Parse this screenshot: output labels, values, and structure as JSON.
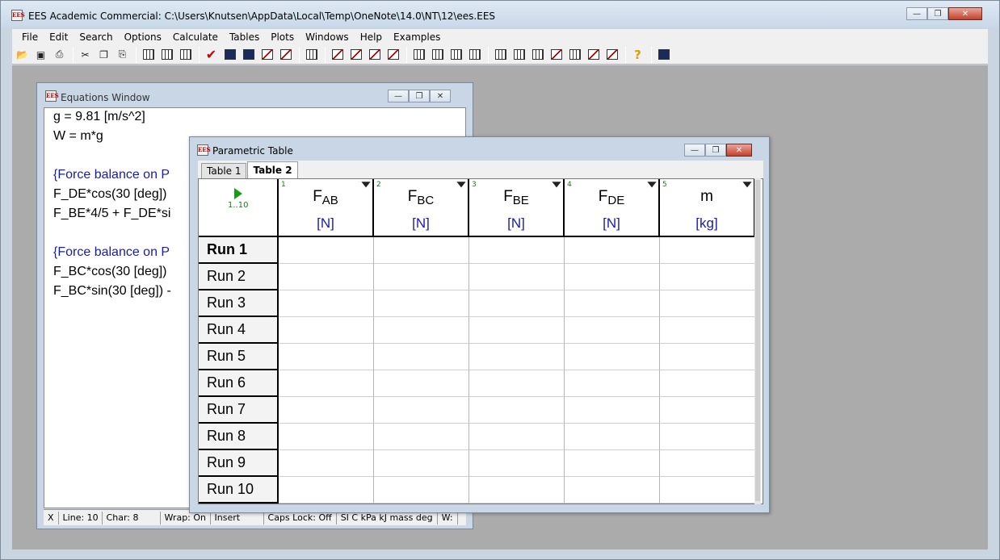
{
  "app": {
    "title": "EES Academic Commercial:  C:\\Users\\Knutsen\\AppData\\Local\\Temp\\OneNote\\14.0\\NT\\12\\ees.EES",
    "icon_text": "EES"
  },
  "menu": [
    "File",
    "Edit",
    "Search",
    "Options",
    "Calculate",
    "Tables",
    "Plots",
    "Windows",
    "Help",
    "Examples"
  ],
  "equations_window": {
    "title": "Equations Window",
    "lines": [
      "g = 9.81 [m/s^2]",
      "W = m*g",
      "",
      "{Force balance on P",
      "F_DE*cos(30 [deg])",
      "F_BE*4/5 + F_DE*si",
      "",
      "{Force balance on P",
      "F_BC*cos(30 [deg])",
      "F_BC*sin(30 [deg]) -"
    ],
    "status": {
      "mode": "X",
      "line": "Line: 10",
      "char": "Char: 8",
      "wrap": "Wrap: On",
      "insert": "Insert",
      "caps": "Caps Lock: Off",
      "units": "SI C kPa kJ mass deg",
      "extra": "W:"
    }
  },
  "parametric_window": {
    "title": "Parametric Table",
    "tabs": [
      "Table 1",
      "Table 2"
    ],
    "active_tab": "Table 2",
    "run_range": "1..10",
    "columns": [
      {
        "num": "1",
        "base": "F",
        "sub": "AB",
        "unit": "[N]"
      },
      {
        "num": "2",
        "base": "F",
        "sub": "BC",
        "unit": "[N]"
      },
      {
        "num": "3",
        "base": "F",
        "sub": "BE",
        "unit": "[N]"
      },
      {
        "num": "4",
        "base": "F",
        "sub": "DE",
        "unit": "[N]"
      },
      {
        "num": "5",
        "base": "m",
        "sub": "",
        "unit": "[kg]"
      }
    ],
    "rows": [
      "Run 1",
      "Run 2",
      "Run 3",
      "Run 4",
      "Run 5",
      "Run 6",
      "Run 7",
      "Run 8",
      "Run 9",
      "Run 10"
    ]
  },
  "toolbar": {
    "icons": [
      "open-icon",
      "save-icon",
      "print-icon",
      "sep",
      "cut-icon",
      "copy-icon",
      "paste-icon",
      "sep",
      "info-icon",
      "list-icon",
      "units-icon",
      "sep",
      "check-icon",
      "calculator-icon",
      "formatted-equations-icon",
      "plot-icon",
      "diagram-icon",
      "sep",
      "table-icon",
      "sep",
      "plot-1-icon",
      "plot-2-icon",
      "plot-3-icon",
      "plot-4-icon",
      "sep",
      "solution-icon",
      "arrays-icon",
      "residuals-icon",
      "report-icon",
      "sep",
      "param-table-icon",
      "lookup-table-icon",
      "integral-table-icon",
      "plot-window-icon",
      "table-grid-icon",
      "diagram-window-icon",
      "align-icon",
      "sep",
      "help-icon",
      "sep",
      "calculator-window-icon"
    ]
  }
}
